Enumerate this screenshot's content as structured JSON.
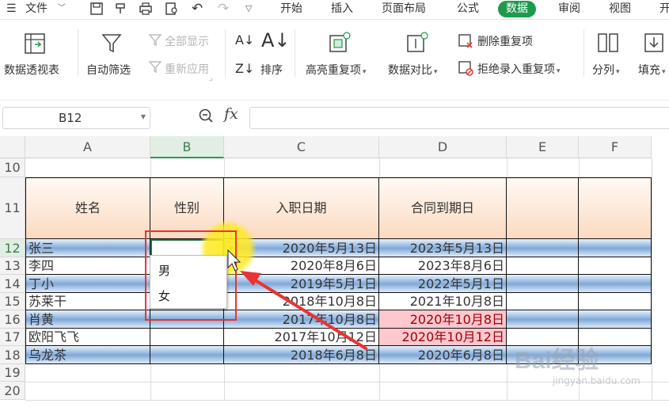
{
  "menubar": {
    "file": "文件",
    "tabs": [
      "开始",
      "插入",
      "页面布局",
      "公式",
      "数据",
      "审阅",
      "视图",
      "开"
    ],
    "active_tab": "数据"
  },
  "ribbon": {
    "pivot": "数据透视表",
    "autofilter": "自动筛选",
    "show_all": "全部显示",
    "reapply": "重新应用",
    "sort": "排序",
    "highlight_dup": "高亮重复项",
    "data_compare": "数据对比",
    "remove_dup": "删除重复项",
    "reject_dup": "拒绝录入重复项",
    "split": "分列",
    "fill": "填充"
  },
  "formula_bar": {
    "name_box": "B12",
    "fx": "fx",
    "value": ""
  },
  "columns": [
    "A",
    "B",
    "C",
    "D",
    "E",
    "F"
  ],
  "selected_column": "B",
  "rows": [
    {
      "num": "10",
      "name": "",
      "gender": "",
      "start": "",
      "end": ""
    },
    {
      "num": "11",
      "name": "姓名",
      "gender": "性别",
      "start": "入职日期",
      "end": "合同到期日"
    },
    {
      "num": "12",
      "name": "张三",
      "gender": "",
      "start": "2020年5月13日",
      "end": "2023年5月13日"
    },
    {
      "num": "13",
      "name": "李四",
      "gender": "",
      "start": "2020年8月6日",
      "end": "2023年8月6日"
    },
    {
      "num": "14",
      "name": "丁小",
      "gender": "",
      "start": "2019年5月1日",
      "end": "2022年5月1日"
    },
    {
      "num": "15",
      "name": "苏莱干",
      "gender": "",
      "start": "2018年10月8日",
      "end": "2021年10月8日"
    },
    {
      "num": "16",
      "name": "肖黄",
      "gender": "",
      "start": "2017年10月8日",
      "end": "2020年10月8日"
    },
    {
      "num": "17",
      "name": "欧阳飞飞",
      "gender": "",
      "start": "2017年10月12日",
      "end": "2020年10月12日"
    },
    {
      "num": "18",
      "name": "乌龙茶",
      "gender": "",
      "start": "2018年6月8日",
      "end": "2020年6月8日"
    },
    {
      "num": "19"
    },
    {
      "num": "20"
    }
  ],
  "dropdown": {
    "options": [
      "男",
      "女"
    ]
  },
  "watermark": {
    "brand": "Bai经验",
    "url": "jingyan.baidu.com"
  }
}
